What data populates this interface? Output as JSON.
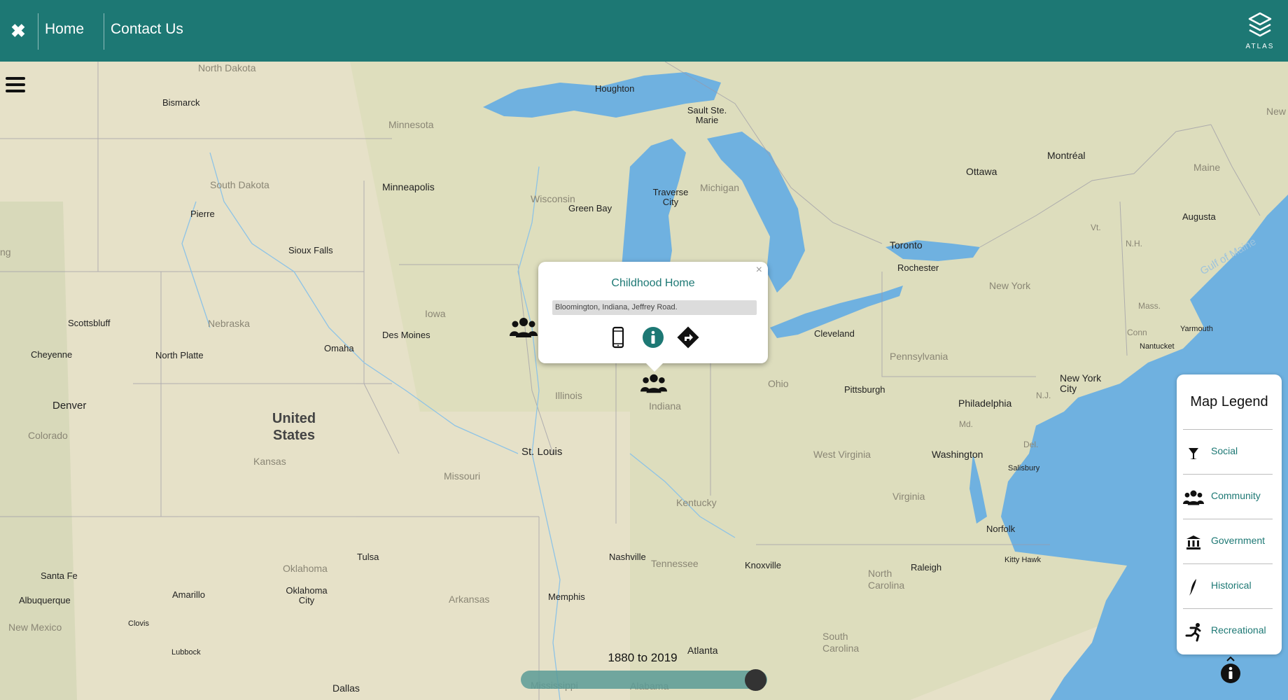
{
  "header": {
    "close_label": "✖",
    "nav": [
      {
        "label": "Home"
      },
      {
        "label": "Contact Us"
      }
    ],
    "logo_text": "ATLAS"
  },
  "map": {
    "labels": {
      "north_dakota": "North Dakota",
      "bismarck": "Bismarck",
      "minnesota": "Minnesota",
      "minneapolis": "Minneapolis",
      "south_dakota": "South Dakota",
      "pierre": "Pierre",
      "sioux_falls": "Sioux Falls",
      "nebraska": "Nebraska",
      "scottsbluff": "Scottsbluff",
      "cheyenne": "Cheyenne",
      "north_platte": "North Platte",
      "omaha": "Omaha",
      "des_moines": "Des Moines",
      "iowa": "Iowa",
      "denver": "Denver",
      "colorado": "Colorado",
      "united_states": "United States",
      "kansas": "Kansas",
      "missouri": "Missouri",
      "st_louis": "St. Louis",
      "illinois": "Illinois",
      "indiana": "Indiana",
      "ohio": "Ohio",
      "wisconsin": "Wisconsin",
      "green_bay": "Green Bay",
      "houghton": "Houghton",
      "sault_ste_marie": "Sault Ste. Marie",
      "traverse_city": "Traverse City",
      "michigan": "Michigan",
      "toronto": "Toronto",
      "rochester": "Rochester",
      "ottawa": "Ottawa",
      "montreal": "Montréal",
      "augusta": "Augusta",
      "maine": "Maine",
      "new_york_state": "New York",
      "new_york_city": "New York City",
      "cleveland": "Cleveland",
      "pittsburgh": "Pittsburgh",
      "pennsylvania": "Pennsylvania",
      "philadelphia": "Philadelphia",
      "washington": "Washington",
      "west_virginia": "West Virginia",
      "virginia": "Virginia",
      "kentucky": "Kentucky",
      "tennessee": "Tennessee",
      "nashville": "Nashville",
      "knoxville": "Knoxville",
      "north_carolina": "North Carolina",
      "raleigh": "Raleigh",
      "norfolk": "Norfolk",
      "salisbury": "Salisbury",
      "kitty_hawk": "Kitty Hawk",
      "yarmouth": "Yarmouth",
      "nantucket": "Nantucket",
      "gulf_of_maine": "Gulf of Maine",
      "mass": "Mass.",
      "conn": "Conn",
      "nh": "N.H.",
      "vt": "Vt.",
      "md": "Md.",
      "nj": "N.J.",
      "del": "Del.",
      "new_partial": "New",
      "ng_partial": "ng",
      "oklahoma": "Oklahoma",
      "oklahoma_city": "Oklahoma City",
      "tulsa": "Tulsa",
      "arkansas": "Arkansas",
      "memphis": "Memphis",
      "atlanta": "Atlanta",
      "south_carolina": "South Carolina",
      "santa_fe": "Santa Fe",
      "albuquerque": "Albuquerque",
      "amarillo": "Amarillo",
      "new_mexico": "New Mexico",
      "clovis": "Clovis",
      "lubbock": "Lubbock",
      "dallas": "Dallas",
      "mississippi": "Mississippi",
      "alabama": "Alabama"
    }
  },
  "popup": {
    "title": "Childhood Home",
    "close": "×",
    "address": "Bloomington, Indiana, Jeffrey Road."
  },
  "legend": {
    "title": "Map Legend",
    "items": [
      {
        "label": "Social",
        "icon": "cocktail-icon"
      },
      {
        "label": "Community",
        "icon": "users-icon"
      },
      {
        "label": "Government",
        "icon": "landmark-icon"
      },
      {
        "label": "Historical",
        "icon": "feather-icon"
      },
      {
        "label": "Recreational",
        "icon": "running-icon"
      }
    ]
  },
  "timeline": {
    "range_label": "1880 to 2019"
  },
  "colors": {
    "header": "#1d7874",
    "accent": "#1d7874",
    "water": "#6fb1e0",
    "land": "#e8e3cc"
  }
}
